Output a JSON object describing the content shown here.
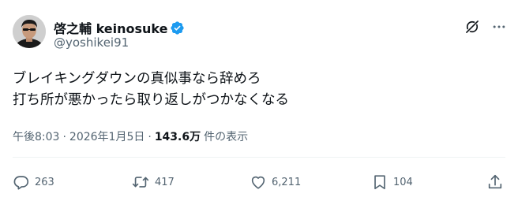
{
  "colors": {
    "text": "#0f1419",
    "secondary": "#536471",
    "verified": "#1d9bf0",
    "divider": "#eff3f4"
  },
  "author": {
    "display_name": "啓之輔 keinosuke",
    "handle": "@yoshikei91",
    "verified_icon": "verified-badge-icon"
  },
  "post": {
    "lines": [
      "ブレイキングダウンの真似事なら辞めろ",
      "打ち所が悪かったら取り返しがつかなくなる"
    ]
  },
  "meta": {
    "time": "午後8:03",
    "separator": "·",
    "date": "2026年1月5日",
    "separator2": "·",
    "views_count": "143.6万",
    "views_label": "件の表示"
  },
  "actions": {
    "reply": {
      "icon": "reply-icon",
      "count": "263"
    },
    "repost": {
      "icon": "repost-icon",
      "count": "417"
    },
    "like": {
      "icon": "heart-icon",
      "count": "6,211"
    },
    "bookmark": {
      "icon": "bookmark-icon",
      "count": "104"
    },
    "share": {
      "icon": "share-icon"
    }
  },
  "top_icons": [
    "grok-icon",
    "more-icon"
  ]
}
